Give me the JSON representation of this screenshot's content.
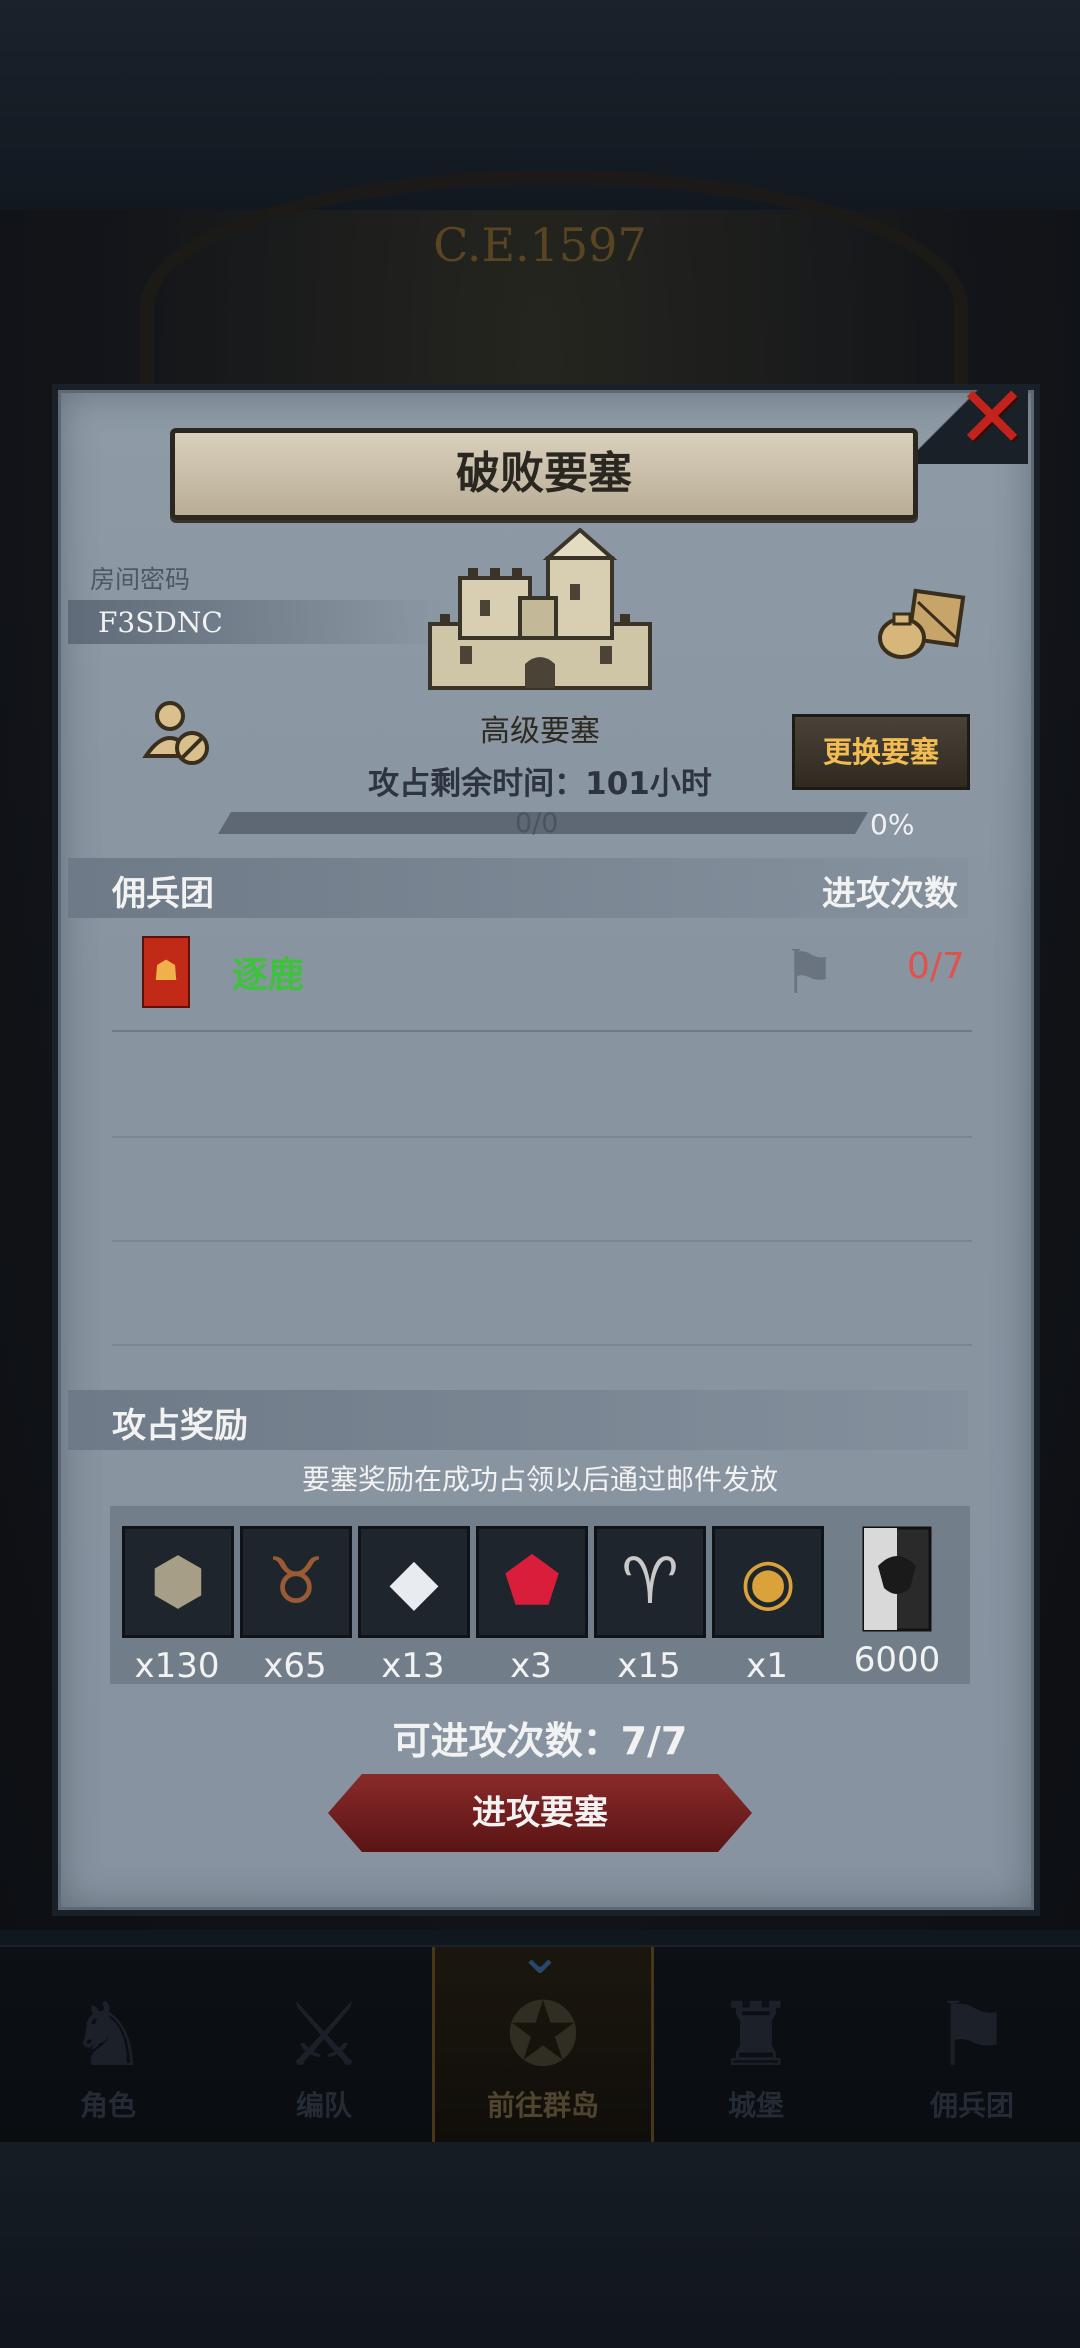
{
  "background": {
    "year": "C.E.1597"
  },
  "nav": {
    "items": [
      {
        "label": "角色",
        "icon": "knight-icon"
      },
      {
        "label": "编队",
        "icon": "formation-icon"
      },
      {
        "label": "前往群岛",
        "icon": "compass-icon",
        "active": true
      },
      {
        "label": "城堡",
        "icon": "castle-icon"
      },
      {
        "label": "佣兵团",
        "icon": "mercenary-icon"
      }
    ]
  },
  "panel": {
    "title": "破败要塞",
    "room_code_label": "房间密码",
    "room_code": "F3SDNC",
    "fortress_name": "高级要塞",
    "change_button": "更换要塞",
    "time_left": "攻占剩余时间：101小时",
    "progress_text": "0/0",
    "progress_percent": "0%",
    "progress_fraction": 0,
    "mercenary_header": "佣兵团",
    "attack_count_header": "进攻次数",
    "mercenaries": [
      {
        "name": "逐鹿",
        "count": "0/7"
      }
    ],
    "rewards_header": "攻占奖励",
    "rewards_note": "要塞奖励在成功占领以后通过邮件发放",
    "rewards": [
      {
        "icon": "stone-icon",
        "qty": "x130"
      },
      {
        "icon": "cattle-icon",
        "qty": "x65"
      },
      {
        "icon": "diamond-icon",
        "qty": "x13"
      },
      {
        "icon": "ruby-icon",
        "qty": "x3"
      },
      {
        "icon": "horns-icon",
        "qty": "x15"
      },
      {
        "icon": "gold-medal-icon",
        "qty": "x1"
      },
      {
        "icon": "bull-banner-icon",
        "qty": "6000"
      }
    ],
    "attempts_text": "可进攻次数：7/7",
    "attack_button": "进攻要塞"
  },
  "colors": {
    "close": "#c2231c",
    "mercenary_name": "#3ec23b",
    "attack_count": "#e0524a",
    "change_button_text": "#f2bc52"
  }
}
